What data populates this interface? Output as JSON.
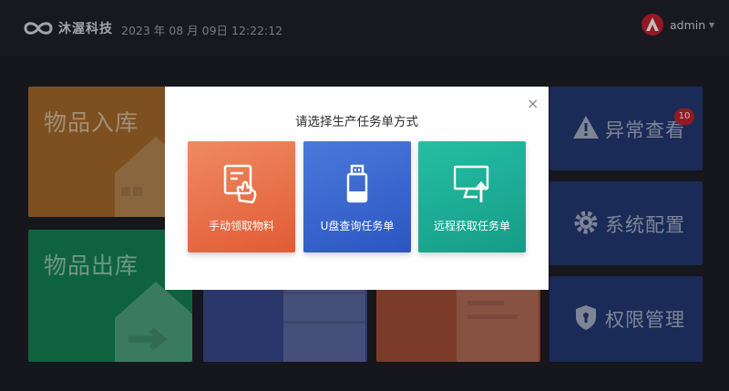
{
  "header": {
    "brand": "沐渥科技",
    "datetime": "2023 年 08 月 09日 12:22:12",
    "username": "admin",
    "caret": "▼"
  },
  "tiles": {
    "stock_in": "物品入库",
    "stock_out": "物品出库",
    "abnormal": "异常查看",
    "abnormal_badge": "10",
    "system_config": "系统配置",
    "permission": "权限管理"
  },
  "dialog": {
    "title": "请选择生产任务单方式",
    "close": "×",
    "options": [
      {
        "label": "手动领取物料",
        "icon": "hand-touch-icon"
      },
      {
        "label": "U盘查询任务单",
        "icon": "usb-drive-icon"
      },
      {
        "label": "远程获取任务单",
        "icon": "monitor-upload-icon"
      }
    ]
  },
  "colors": {
    "manual": "#e8704a",
    "usb": "#3a68cf",
    "remote": "#1cae96",
    "side_tile": "#253a76",
    "badge": "#c4232f"
  }
}
